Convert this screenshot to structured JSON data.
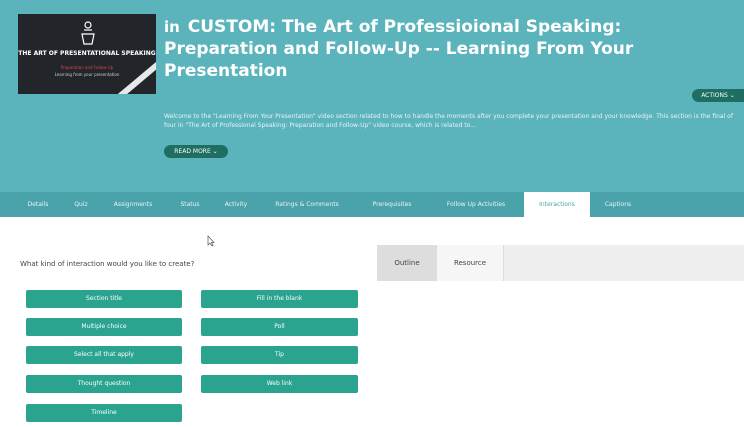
{
  "course": {
    "title_badge": "in",
    "title": "CUSTOM: The Art of Professioional Speaking: Preparation and Follow-Up -- Learning From Your Presentation",
    "thumbnail_title": "THE ART OF PRESENTATIONAL SPEAKING",
    "thumbnail_subtitle": "Preparation and Follow-Up",
    "thumbnail_caption": "Learning from your presentation",
    "description": "Welcome to the \"Learning From Your Presentation\" video section related to how to handle the moments after you complete your presentation and your knowledge. This section is the final of four in \"The Art of Professional Speaking: Preparation and Follow-Up\" video course, which is related to...",
    "read_more_label": "READ MORE",
    "actions_label": "ACTIONS"
  },
  "tabs": [
    {
      "label": "Details"
    },
    {
      "label": "Quiz"
    },
    {
      "label": "Assignments"
    },
    {
      "label": "Status"
    },
    {
      "label": "Activity"
    },
    {
      "label": "Ratings & Comments"
    },
    {
      "label": "Prerequisites"
    },
    {
      "label": "Follow Up Activities"
    },
    {
      "label": "Interactions"
    },
    {
      "label": "Captions"
    }
  ],
  "interactions": {
    "question": "What kind of interaction would you like to create?",
    "left_buttons": [
      "Section title",
      "Multiple choice",
      "Select all that apply",
      "Thought question",
      "Timeline"
    ],
    "right_buttons": [
      "Fill in the blank",
      "Poll",
      "Tip",
      "Web link"
    ]
  },
  "panel": {
    "tabs": [
      "Outline",
      "Resource"
    ]
  },
  "colors": {
    "hero": "#5bb4bc",
    "tabbar": "#4aa2aa",
    "button": "#2aa38f",
    "dark_button": "#1f6e62"
  }
}
